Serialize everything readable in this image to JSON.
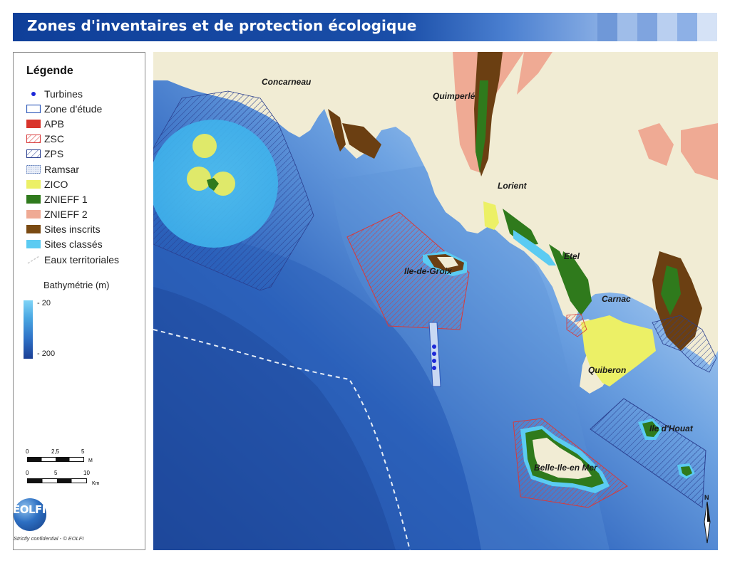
{
  "title": "Zones d'inventaires et de protection écologique",
  "legend": {
    "heading": "Légende",
    "items": [
      {
        "label": "Turbines",
        "symbol": "turbine-dot-icon",
        "color": "#1d28d8"
      },
      {
        "label": "Zone d'étude",
        "symbol": "study-zone-icon",
        "color": "#2a56b8"
      },
      {
        "label": "APB",
        "symbol": "apb-icon",
        "color": "#d9342b"
      },
      {
        "label": "ZSC",
        "symbol": "zsc-hatch-icon",
        "color": "#d83a3a"
      },
      {
        "label": "ZPS",
        "symbol": "zps-hatch-icon",
        "color": "#2a3f8f"
      },
      {
        "label": "Ramsar",
        "symbol": "ramsar-icon",
        "color": "#5a7ab8"
      },
      {
        "label": "ZICO",
        "symbol": "zico-icon",
        "color": "#ecf066"
      },
      {
        "label": "ZNIEFF 1",
        "symbol": "znieff1-icon",
        "color": "#2f7a1c"
      },
      {
        "label": "ZNIEFF 2",
        "symbol": "znieff2-icon",
        "color": "#efaa94"
      },
      {
        "label": "Sites inscrits",
        "symbol": "sites-inscrits-icon",
        "color": "#7a4a12"
      },
      {
        "label": "Sites classés",
        "symbol": "sites-classes-icon",
        "color": "#5bcbf2"
      },
      {
        "label": "Eaux territoriales",
        "symbol": "dashed-line-icon",
        "color": "#cccccc"
      }
    ],
    "bathymetry": {
      "title": "Bathymétrie (m)",
      "shallow": "- 20",
      "deep": "- 200"
    },
    "scale_nm": {
      "ticks": [
        "0",
        "2,5",
        "5"
      ],
      "unit": "M"
    },
    "scale_km": {
      "ticks": [
        "0",
        "5",
        "10"
      ],
      "unit": "Km"
    },
    "logo": "EOLFI",
    "footer": "Strictly confidential - © EOLFI"
  },
  "map": {
    "places": [
      "Concarneau",
      "Quimperlé",
      "Lorient",
      "Ile-de-Groix",
      "Etel",
      "Carnac",
      "Quiberon",
      "Belle-Ile-en Mer",
      "Ile d'Houat"
    ],
    "north_label": "N",
    "turbine_count": 4
  },
  "colors": {
    "land": "#f1ecd4",
    "sea_shallow": "#cfe3f8",
    "sea_deep": "#2452a8",
    "title_bar": "#0f3f99"
  }
}
